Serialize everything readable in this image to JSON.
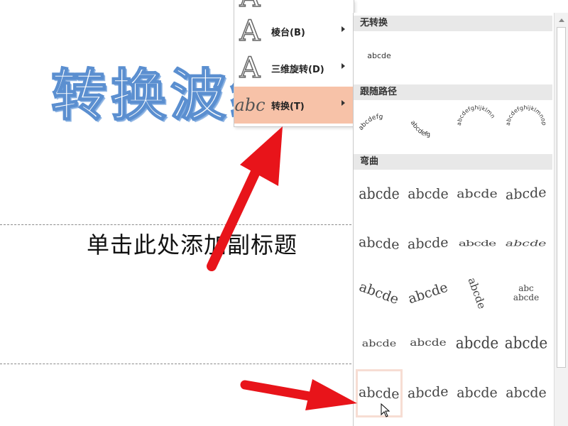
{
  "slide": {
    "title_wordart": "转换波纹",
    "subtitle": "单击此处添加副标题"
  },
  "menu_level1": {
    "items": [
      {
        "icon": "A",
        "label": "棱台(B)"
      },
      {
        "icon": "A",
        "label": "三维旋转(D)"
      },
      {
        "icon": "abc",
        "label": "转换(T)"
      }
    ]
  },
  "menu_level2": {
    "sections": {
      "none": "无转换",
      "follow_path": "跟随路径",
      "warp": "弯曲"
    },
    "no_transform_sample": "abcde",
    "follow_path_samples": [
      "abcdefg",
      "abcdefg",
      "abcdefghijklmn",
      "abcdefghijklmnop"
    ],
    "warp_samples": [
      "abcde",
      "abcde",
      "abcde",
      "abcde",
      "abcde",
      "abcde",
      "abcde",
      "abcde",
      "abcde",
      "abcde",
      "abcde",
      "abc abcde",
      "abcde",
      "abcde",
      "abcde",
      "abcde",
      "abcde",
      "abcde",
      "abcde",
      "abcde"
    ]
  },
  "colors": {
    "highlight": "#f7c2a8",
    "arrow": "#e8141a",
    "wordart_outline": "#5b8fd0"
  }
}
